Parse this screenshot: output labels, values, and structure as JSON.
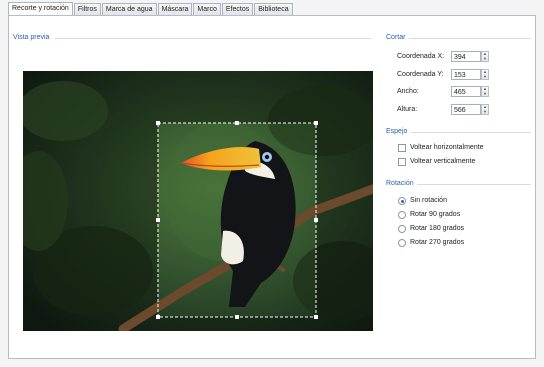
{
  "tabs": [
    "Recorte y rotación",
    "Filtros",
    "Marca de agua",
    "Máscara",
    "Marco",
    "Efectos",
    "Biblioteca"
  ],
  "preview": {
    "title": "Vista previa"
  },
  "crop": {
    "title": "Cortar",
    "fields": [
      {
        "label": "Coordenada X:",
        "value": "394"
      },
      {
        "label": "Coordenada Y:",
        "value": "153"
      },
      {
        "label": "Ancho:",
        "value": "465"
      },
      {
        "label": "Altura:",
        "value": "566"
      }
    ]
  },
  "mirror": {
    "title": "Espejo",
    "options": [
      {
        "label": "Voltear horizontalmente",
        "checked": false
      },
      {
        "label": "Voltear verticalmente",
        "checked": false
      }
    ]
  },
  "rotation": {
    "title": "Rotación",
    "options": [
      {
        "label": "Sin rotación",
        "selected": true
      },
      {
        "label": "Rotar 90 grados",
        "selected": false
      },
      {
        "label": "Rotar 180 grados",
        "selected": false
      },
      {
        "label": "Rotar 270 grados",
        "selected": false
      }
    ]
  },
  "colors": {
    "section_title": "#2a5db0",
    "toucan_beak": "#f6a21b",
    "foliage": "#2f4a2a"
  }
}
